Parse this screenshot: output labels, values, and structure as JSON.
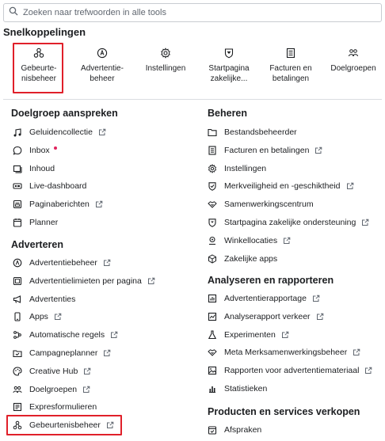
{
  "search": {
    "placeholder": "Zoeken naar trefwoorden in alle tools"
  },
  "shortcuts": {
    "title": "Snelkoppelingen",
    "items": [
      {
        "line1": "Gebeurte-",
        "line2": "nisbeheer",
        "icon": "event-manager-icon"
      },
      {
        "line1": "Advertentie-",
        "line2": "beheer",
        "icon": "ads-manager-icon"
      },
      {
        "line1": "Instellingen",
        "line2": "",
        "icon": "gear-icon"
      },
      {
        "line1": "Startpagina",
        "line2": "zakelijke...",
        "icon": "shield-icon"
      },
      {
        "line1": "Facturen en",
        "line2": "betalingen",
        "icon": "invoice-icon"
      },
      {
        "line1": "Doelgroepen",
        "line2": "",
        "icon": "audience-icon"
      }
    ]
  },
  "left": {
    "audience": {
      "title": "Doelgroep aanspreken",
      "items": [
        {
          "label": "Geluidencollectie",
          "icon": "music-note-icon"
        },
        {
          "label": "Inbox",
          "icon": "chat-bubble-icon"
        },
        {
          "label": "Inhoud",
          "icon": "content-icon"
        },
        {
          "label": "Live-dashboard",
          "icon": "live-icon"
        },
        {
          "label": "Paginaberichten",
          "icon": "page-posts-icon"
        },
        {
          "label": "Planner",
          "icon": "calendar-icon"
        }
      ]
    },
    "advertising": {
      "title": "Adverteren",
      "items": [
        {
          "label": "Advertentiebeheer",
          "icon": "ads-manager-icon"
        },
        {
          "label": "Advertentielimieten per pagina",
          "icon": "limits-icon"
        },
        {
          "label": "Advertenties",
          "icon": "megaphone-icon"
        },
        {
          "label": "Apps",
          "icon": "phone-icon"
        },
        {
          "label": "Automatische regels",
          "icon": "rules-icon"
        },
        {
          "label": "Campagneplanner",
          "icon": "folder-check-icon"
        },
        {
          "label": "Creative Hub",
          "icon": "palette-icon"
        },
        {
          "label": "Doelgroepen",
          "icon": "audience-icon"
        },
        {
          "label": "Expresformulieren",
          "icon": "form-icon"
        },
        {
          "label": "Gebeurtenisbeheer",
          "icon": "event-manager-icon"
        }
      ]
    }
  },
  "right": {
    "manage": {
      "title": "Beheren",
      "items": [
        {
          "label": "Bestandsbeheerder",
          "icon": "folder-icon"
        },
        {
          "label": "Facturen en betalingen",
          "icon": "invoice-icon"
        },
        {
          "label": "Instellingen",
          "icon": "gear-icon"
        },
        {
          "label": "Merkveiligheid en -geschiktheid",
          "icon": "shield-check-icon"
        },
        {
          "label": "Samenwerkingscentrum",
          "icon": "handshake-icon"
        },
        {
          "label": "Startpagina zakelijke ondersteuning",
          "icon": "shield-icon"
        },
        {
          "label": "Winkellocaties",
          "icon": "location-icon"
        },
        {
          "label": "Zakelijke apps",
          "icon": "cube-icon"
        }
      ]
    },
    "analyze": {
      "title": "Analyseren en rapporteren",
      "items": [
        {
          "label": "Advertentierapportage",
          "icon": "report-icon"
        },
        {
          "label": "Analyserapport verkeer",
          "icon": "traffic-report-icon"
        },
        {
          "label": "Experimenten",
          "icon": "flask-icon"
        },
        {
          "label": "Meta Merksamenwerkingsbeheer",
          "icon": "handshake-icon"
        },
        {
          "label": "Rapporten voor advertentiemateriaal",
          "icon": "image-report-icon"
        },
        {
          "label": "Statistieken",
          "icon": "bar-chart-icon"
        }
      ]
    },
    "sell": {
      "title": "Producten en services verkopen",
      "items": [
        {
          "label": "Afspraken",
          "icon": "appointment-icon"
        }
      ]
    }
  },
  "colors": {
    "highlight": "#e0202a",
    "notification": "#e0245e",
    "text": "#1c1e21"
  }
}
